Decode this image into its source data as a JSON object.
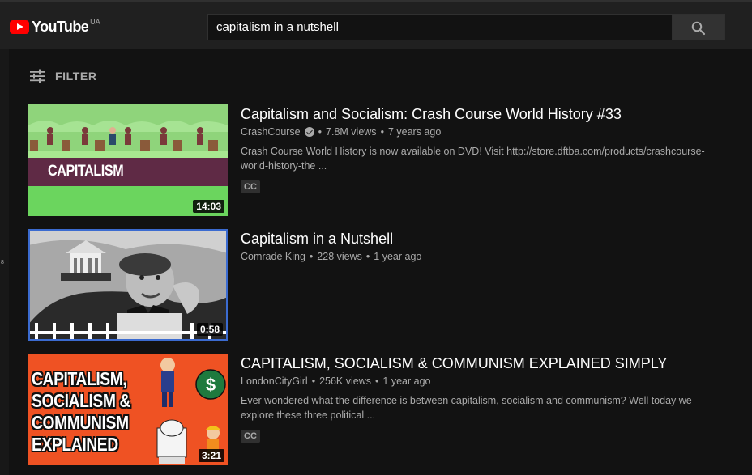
{
  "header": {
    "logo_text": "YouTube",
    "region": "UA",
    "search_value": "capitalism in a nutshell"
  },
  "sidebar_stub": {
    "mark": "8"
  },
  "filter": {
    "label": "FILTER"
  },
  "results": [
    {
      "title": "Capitalism and Socialism: Crash Course World History #33",
      "channel": "CrashCourse",
      "verified": true,
      "views": "7.8M views",
      "age": "7 years ago",
      "description": "Crash Course World History is now available on DVD! Visit http://store.dftba.com/products/crashcourse-world-history-the ...",
      "badge": "CC",
      "duration": "14:03",
      "thumbnail_text": "CAPITALISM"
    },
    {
      "title": "Capitalism in a Nutshell",
      "channel": "Comrade King",
      "verified": false,
      "views": "228 views",
      "age": "1 year ago",
      "description": "",
      "badge": "",
      "duration": "0:58"
    },
    {
      "title": "CAPITALISM, SOCIALISM & COMMUNISM EXPLAINED SIMPLY",
      "channel": "LondonCityGirl",
      "verified": false,
      "views": "256K views",
      "age": "1 year ago",
      "description": "Ever wondered what the difference is between capitalism, socialism and communism? Well today we explore these three political ...",
      "badge": "CC",
      "duration": "3:21",
      "thumbnail_lines": [
        "CAPITALISM,",
        "SOCIALISM &",
        "COMMUNISM",
        "EXPLAINED"
      ]
    }
  ],
  "colors": {
    "background": "#121212",
    "header": "#202020",
    "brand_red": "#ff0000",
    "thumb3_orange": "#ef5223"
  }
}
